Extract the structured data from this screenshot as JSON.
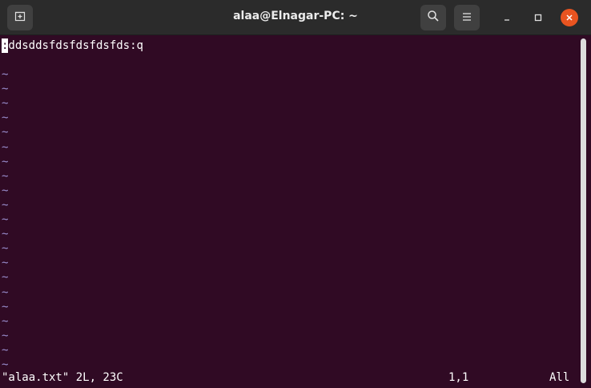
{
  "titlebar": {
    "title": "alaa@Elnagar-PC: ~",
    "new_tab_icon": "new-tab-icon",
    "search_icon": "search-icon",
    "menu_icon": "hamburger-menu-icon",
    "minimize_icon": "minimize-icon",
    "maximize_icon": "maximize-icon",
    "close_icon": "close-icon"
  },
  "terminal": {
    "cursor_char": ":",
    "first_line": "ddsddsfdsfdsfdsfds:q",
    "tilde": "~",
    "tilde_count": 21,
    "status_file": "\"alaa.txt\" 2L, 23C",
    "status_position": "1,1",
    "status_scroll": "All"
  },
  "colors": {
    "terminal_bg": "#300a24",
    "titlebar_bg": "#2b2b2b",
    "close_button": "#e95420",
    "tilde": "#9b8fd0"
  }
}
